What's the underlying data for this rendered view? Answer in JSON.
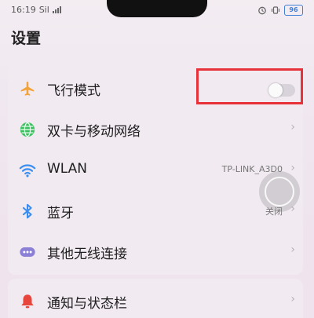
{
  "status_bar": {
    "time": "16:19",
    "signal_text": "Sil",
    "battery": "96"
  },
  "page": {
    "title": "设置"
  },
  "settings": [
    {
      "label": "飞行模式",
      "icon": "airplane-icon",
      "control": "toggle",
      "toggle_on": false
    },
    {
      "label": "双卡与移动网络",
      "icon": "globe-icon",
      "control": "chevron"
    },
    {
      "label": "WLAN",
      "icon": "wifi-icon",
      "control": "chevron",
      "value": "TP-LINK_A3D0"
    },
    {
      "label": "蓝牙",
      "icon": "bluetooth-icon",
      "control": "chevron",
      "value": "关闭"
    },
    {
      "label": "其他无线连接",
      "icon": "more-connections-icon",
      "control": "chevron"
    }
  ],
  "settings_group_2": [
    {
      "label": "通知与状态栏",
      "icon": "bell-icon",
      "control": "chevron"
    }
  ],
  "colors": {
    "airplane": "#f2a33a",
    "globe": "#3cbf5e",
    "wifi": "#3a8ef0",
    "bluetooth": "#3a8ef0",
    "more": "#8b7fd6",
    "bell": "#e8453c",
    "highlight": "#e8323a"
  }
}
